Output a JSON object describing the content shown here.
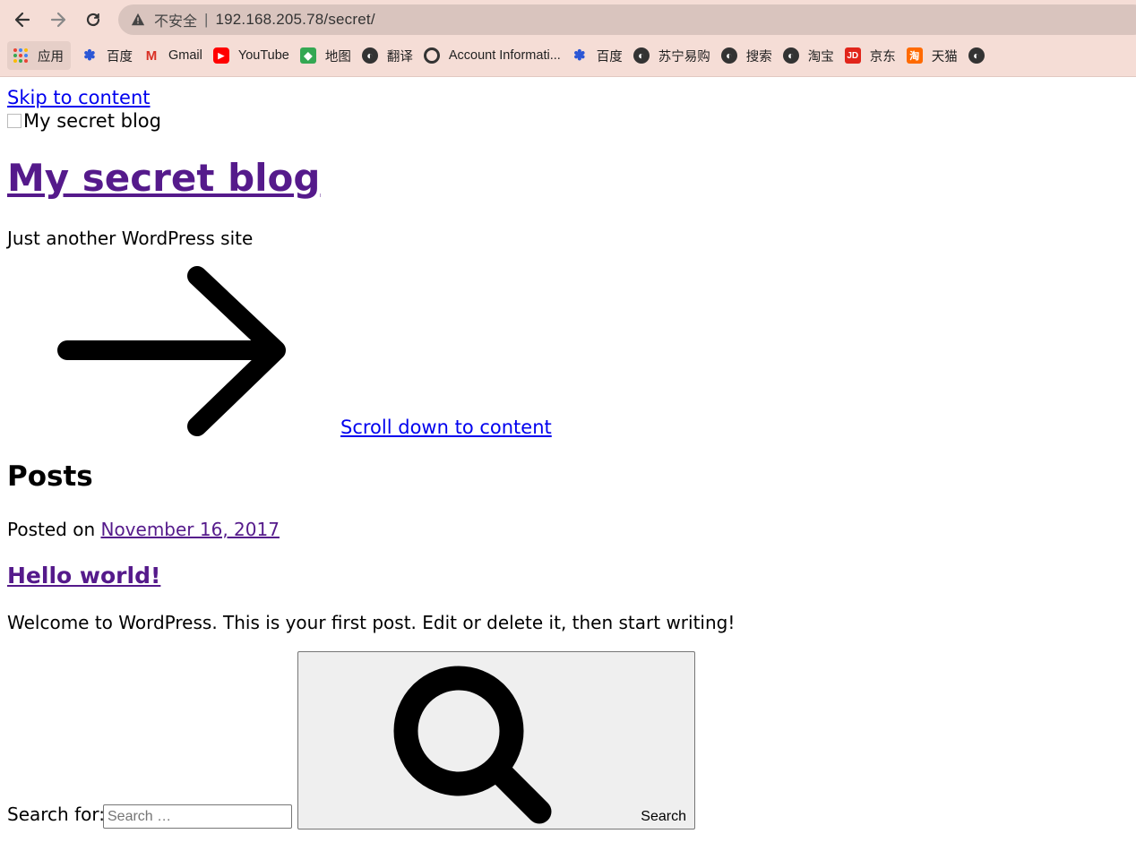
{
  "browser": {
    "security_label": "不安全",
    "separator": "|",
    "url": "192.168.205.78/secret/",
    "bookmarks": [
      {
        "label": "应用",
        "icon": "apps-grid-icon"
      },
      {
        "label": "百度",
        "icon": "baidu-icon"
      },
      {
        "label": "Gmail",
        "icon": "gmail-icon"
      },
      {
        "label": "YouTube",
        "icon": "youtube-icon"
      },
      {
        "label": "地图",
        "icon": "maps-icon"
      },
      {
        "label": "翻译",
        "icon": "globe-icon"
      },
      {
        "label": "Account Informati...",
        "icon": "account-icon"
      },
      {
        "label": "百度",
        "icon": "baidu-icon"
      },
      {
        "label": "苏宁易购",
        "icon": "globe-icon"
      },
      {
        "label": "搜索",
        "icon": "globe-icon"
      },
      {
        "label": "淘宝",
        "icon": "globe-icon"
      },
      {
        "label": "京东",
        "icon": "jd-icon"
      },
      {
        "label": "天猫",
        "icon": "tmall-icon"
      }
    ]
  },
  "page": {
    "skip_link": "Skip to content",
    "logo_alt": "My secret blog",
    "site_title": "My secret blog",
    "tagline": "Just another WordPress site",
    "scroll_link": "Scroll down to content",
    "posts_heading": "Posts",
    "posted_prefix": "Posted on ",
    "post_date": "November 16, 2017",
    "post_title": "Hello world!",
    "excerpt": "Welcome to WordPress. This is your first post. Edit or delete it, then start writing!",
    "search_label": "Search for:",
    "search_placeholder": "Search …",
    "search_button": "Search"
  },
  "colors": {
    "chrome_bg": "#f5ddd6",
    "omnibox_bg": "#d9c4be",
    "link": "#0000ee",
    "visited_link": "#551a8b"
  }
}
